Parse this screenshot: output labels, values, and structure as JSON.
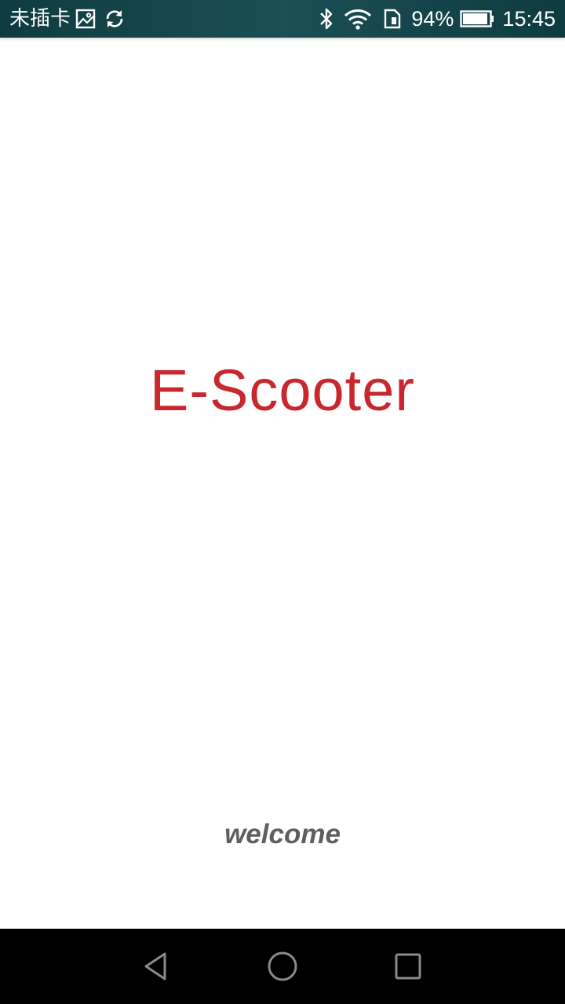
{
  "status_bar": {
    "carrier": "未插卡",
    "battery_percent": "94%",
    "battery_level": 0.94,
    "time": "15:45",
    "icons": [
      "image-icon",
      "sync-icon",
      "bluetooth-icon",
      "wifi-icon",
      "sim-icon",
      "battery-icon"
    ]
  },
  "splash": {
    "title": "E-Scooter",
    "subtitle": "welcome"
  },
  "nav_bar": {
    "buttons": [
      "back-icon",
      "home-icon",
      "recents-icon"
    ]
  },
  "colors": {
    "title": "#c8272d",
    "subtitle": "#5f5f5f",
    "status_bar": "#1b4f55",
    "nav_bar": "#000000"
  }
}
